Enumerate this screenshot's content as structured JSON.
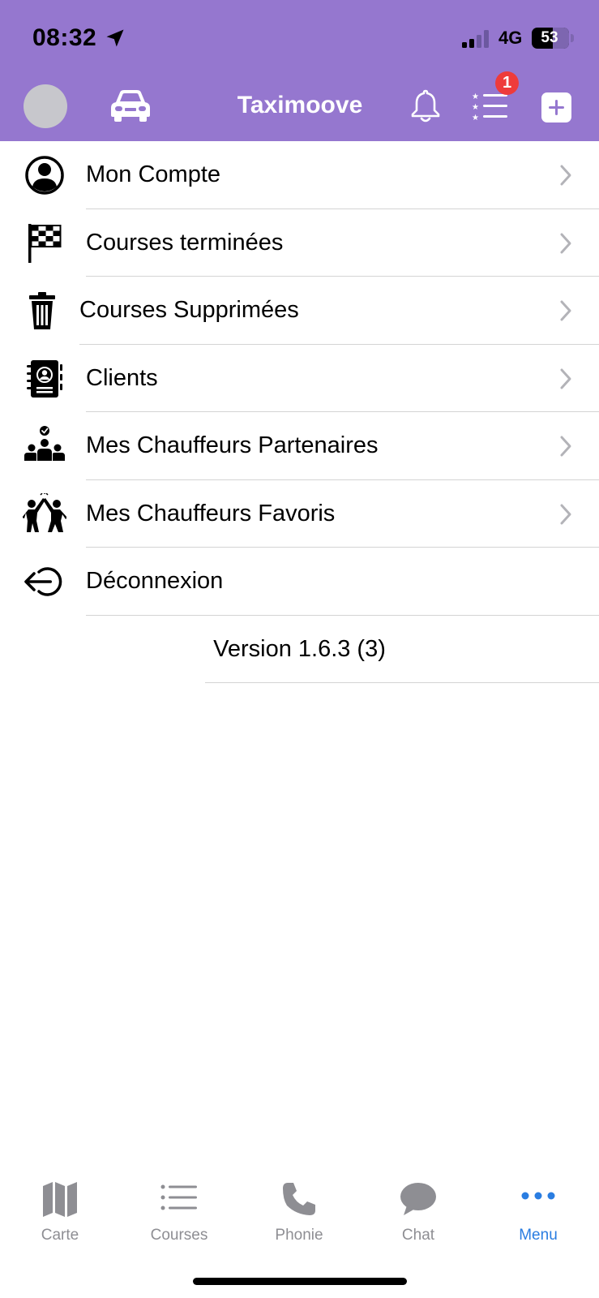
{
  "status_bar": {
    "time": "08:32",
    "network": "4G",
    "battery": "53"
  },
  "header": {
    "title": "Taximoove",
    "notification_badge": "1"
  },
  "menu": {
    "items": [
      {
        "label": "Mon Compte",
        "icon": "account-icon"
      },
      {
        "label": "Courses terminées",
        "icon": "checkered-flag-icon"
      },
      {
        "label": "Courses Supprimées",
        "icon": "trash-icon"
      },
      {
        "label": "Clients",
        "icon": "contacts-book-icon"
      },
      {
        "label": "Mes Chauffeurs Partenaires",
        "icon": "team-icon"
      },
      {
        "label": "Mes Chauffeurs Favoris",
        "icon": "high-five-icon"
      },
      {
        "label": "Déconnexion",
        "icon": "logout-icon"
      }
    ],
    "version": "Version 1.6.3 (3)"
  },
  "tabbar": {
    "tabs": [
      {
        "label": "Carte",
        "icon": "map-icon"
      },
      {
        "label": "Courses",
        "icon": "list-icon"
      },
      {
        "label": "Phonie",
        "icon": "phone-icon"
      },
      {
        "label": "Chat",
        "icon": "chat-bubble-icon"
      },
      {
        "label": "Menu",
        "icon": "more-dots-icon"
      }
    ],
    "active": "Menu",
    "active_color": "#2a7de1",
    "inactive_color": "#8e8e93"
  },
  "colors": {
    "header_bg": "#9577cf",
    "badge": "#ee3b3b"
  }
}
